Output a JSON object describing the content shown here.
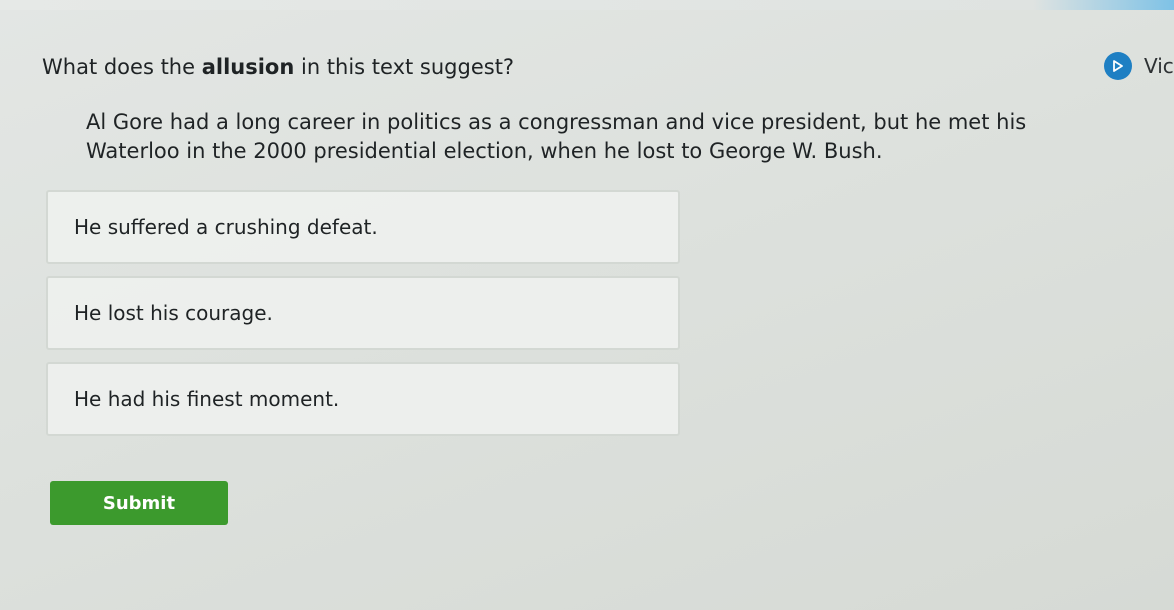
{
  "question": {
    "prefix": "What does the ",
    "emphasis": "allusion",
    "suffix": " in this text suggest?"
  },
  "video_link": {
    "label": "Vic",
    "icon": "play-icon",
    "icon_color": "#1e7fc3"
  },
  "passage": "Al Gore had a long career in politics as a congressman and vice president, but he met his Waterloo in the 2000 presidential election, when he lost to George W. Bush.",
  "choices": [
    "He suffered a crushing defeat.",
    "He lost his courage.",
    "He had his finest moment."
  ],
  "submit_label": "Submit",
  "colors": {
    "submit": "#3c9a2d",
    "accent": "#1e7fc3"
  }
}
